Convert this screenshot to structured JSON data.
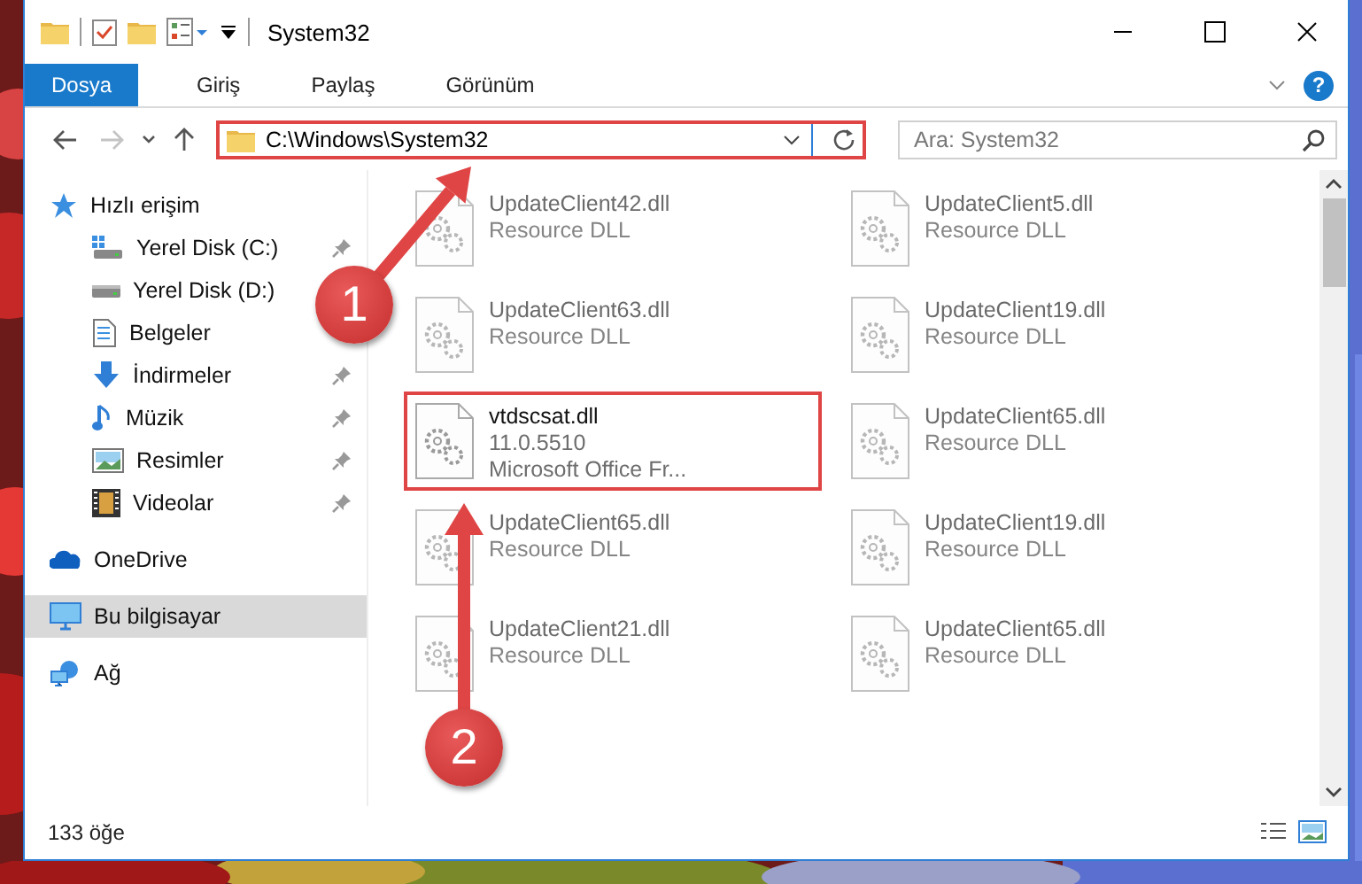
{
  "window": {
    "title": "System32"
  },
  "ribbon": {
    "tabs": [
      {
        "label": "Dosya",
        "selected": true
      },
      {
        "label": "Giriş",
        "selected": false
      },
      {
        "label": "Paylaş",
        "selected": false
      },
      {
        "label": "Görünüm",
        "selected": false
      }
    ],
    "help": "?"
  },
  "nav_buttons": [
    {
      "kind": "back",
      "disabled": false
    },
    {
      "kind": "forward",
      "disabled": true
    },
    {
      "kind": "recent",
      "disabled": false
    },
    {
      "kind": "up",
      "disabled": false
    }
  ],
  "address": {
    "path": "C:\\Windows\\System32",
    "highlighted": true
  },
  "search": {
    "placeholder": "Ara: System32"
  },
  "sidebar": {
    "items": [
      {
        "label": "Hızlı erişim",
        "kind": "quick",
        "selected": false,
        "children": [
          {
            "label": "Yerel Disk (C:)",
            "kind": "system-drive",
            "pinned": true,
            "selected": false
          },
          {
            "label": "Yerel Disk (D:)",
            "kind": "drive",
            "pinned": false,
            "selected": false
          },
          {
            "label": "Belgeler",
            "kind": "documents",
            "pinned": false,
            "selected": false
          },
          {
            "label": "İndirmeler",
            "kind": "downloads",
            "pinned": true,
            "selected": false
          },
          {
            "label": "Müzik",
            "kind": "music",
            "pinned": true,
            "selected": false
          },
          {
            "label": "Resimler",
            "kind": "pictures",
            "pinned": true,
            "selected": false
          },
          {
            "label": "Videolar",
            "kind": "videos",
            "pinned": true,
            "selected": false
          }
        ]
      },
      {
        "label": "OneDrive",
        "kind": "cloud",
        "selected": false
      },
      {
        "label": "Bu bilgisayar",
        "kind": "computer",
        "selected": true
      },
      {
        "label": "Ağ",
        "kind": "network",
        "selected": false
      }
    ]
  },
  "files": [
    {
      "name": "UpdateClient42.dll",
      "details": [
        "Resource DLL"
      ],
      "blurred": true,
      "highlighted": false
    },
    {
      "name": "UpdateClient5.dll",
      "details": [
        "Resource DLL"
      ],
      "blurred": true,
      "highlighted": false
    },
    {
      "name": "UpdateClient63.dll",
      "details": [
        "Resource DLL"
      ],
      "blurred": true,
      "highlighted": false
    },
    {
      "name": "UpdateClient19.dll",
      "details": [
        "Resource DLL"
      ],
      "blurred": true,
      "highlighted": false
    },
    {
      "name": "vtdscsat.dll",
      "details": [
        "11.0.5510",
        "Microsoft Office Fr..."
      ],
      "blurred": false,
      "highlighted": true
    },
    {
      "name": "UpdateClient65.dll",
      "details": [
        "Resource DLL"
      ],
      "blurred": true,
      "highlighted": false
    },
    {
      "name": "UpdateClient65.dll",
      "details": [
        "Resource DLL"
      ],
      "blurred": true,
      "highlighted": false
    },
    {
      "name": "UpdateClient19.dll",
      "details": [
        "Resource DLL"
      ],
      "blurred": true,
      "highlighted": false
    },
    {
      "name": "UpdateClient21.dll",
      "details": [
        "Resource DLL"
      ],
      "blurred": true,
      "highlighted": false
    },
    {
      "name": "UpdateClient65.dll",
      "details": [
        "Resource DLL"
      ],
      "blurred": true,
      "highlighted": false
    }
  ],
  "status_bar": {
    "count": "133 öğe"
  },
  "callouts": [
    {
      "number": "1"
    },
    {
      "number": "2"
    }
  ]
}
